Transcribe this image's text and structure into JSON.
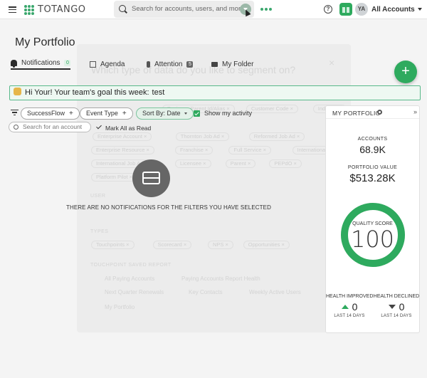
{
  "app": {
    "logo_text": "TOTANGO"
  },
  "header": {
    "search_placeholder": "Search for accounts, users, and more...",
    "avatar_initials": "YA",
    "account_selector": "All Accounts"
  },
  "page": {
    "title": "My Portfolio"
  },
  "tabs": [
    {
      "label": "Notifications",
      "count": "0",
      "active": true,
      "icon": "bell-icon"
    },
    {
      "label": "Agenda",
      "count": "",
      "icon": "agenda-icon"
    },
    {
      "label": "Attention",
      "count": "5",
      "icon": "pin-icon"
    },
    {
      "label": "My Folder",
      "count": "",
      "icon": "folder-icon"
    }
  ],
  "fab": {
    "label": "+"
  },
  "goal": {
    "text": "Hi Your! Your team's goal this week:",
    "value": "test"
  },
  "filters": {
    "chips": [
      {
        "label": "SuccessFlow",
        "suffix": "+"
      },
      {
        "label": "Event Type",
        "suffix": "+"
      },
      {
        "label": "Sort By: Date",
        "suffix": ""
      }
    ],
    "show_activity_label": "Show my activity",
    "account_search_placeholder": "Search for an account",
    "mark_all_read": "Mark All as Read"
  },
  "empty_state": {
    "message": "THERE ARE NO NOTIFICATIONS FOR THE FILTERS YOU HAVE SELECTED"
  },
  "ghost_modal": {
    "title": "Which type of data do you like to segment on?",
    "pills_row1": [
      "Business Parent Id/Alias",
      "Customer Code",
      "Industry"
    ],
    "pills_row2": [
      "Enterprise Account",
      "Thornton Job Ad",
      "Reformed Job Ad"
    ],
    "pills_row3": [
      "Enterprise Resource",
      "Franchise",
      "Full Service",
      "International Job Ad"
    ],
    "pills_row4": [
      "International Job Ad",
      "Licensee",
      "Parent",
      "PEPdO"
    ],
    "pills_row5": [
      "Platform Pilot"
    ],
    "section2": "USER",
    "section3": "TYPES",
    "pills_types": [
      "Touchpoints",
      "Scorecard",
      "NPS",
      "Opportunities"
    ],
    "section4": "TOUCHPOINT SAVED REPORT",
    "items": [
      "All Paying Accounts",
      "Paying Accounts Report Health",
      "Next Quarter Renewals",
      "Key Contacts",
      "Weekly Active Users",
      "My Portfolio"
    ]
  },
  "portfolio": {
    "title": "MY PORTFOLIO",
    "accounts_label": "ACCOUNTS",
    "accounts_value": "68.9K",
    "value_label": "PORTFOLIO VALUE",
    "value_value": "$513.28K",
    "quality_label": "QUALITY SCORE",
    "quality_value": "100",
    "quality_fraction": 1.0,
    "improved_label": "HEALTH IMPROVED",
    "improved_value": "0",
    "declined_label": "HEALTH DECLINED",
    "declined_value": "0",
    "period_label": "LAST 14 DAYS"
  },
  "colors": {
    "brand_green": "#2eaa5e",
    "goal_border": "#58b98a",
    "gauge_track": "#e8e8e8"
  }
}
